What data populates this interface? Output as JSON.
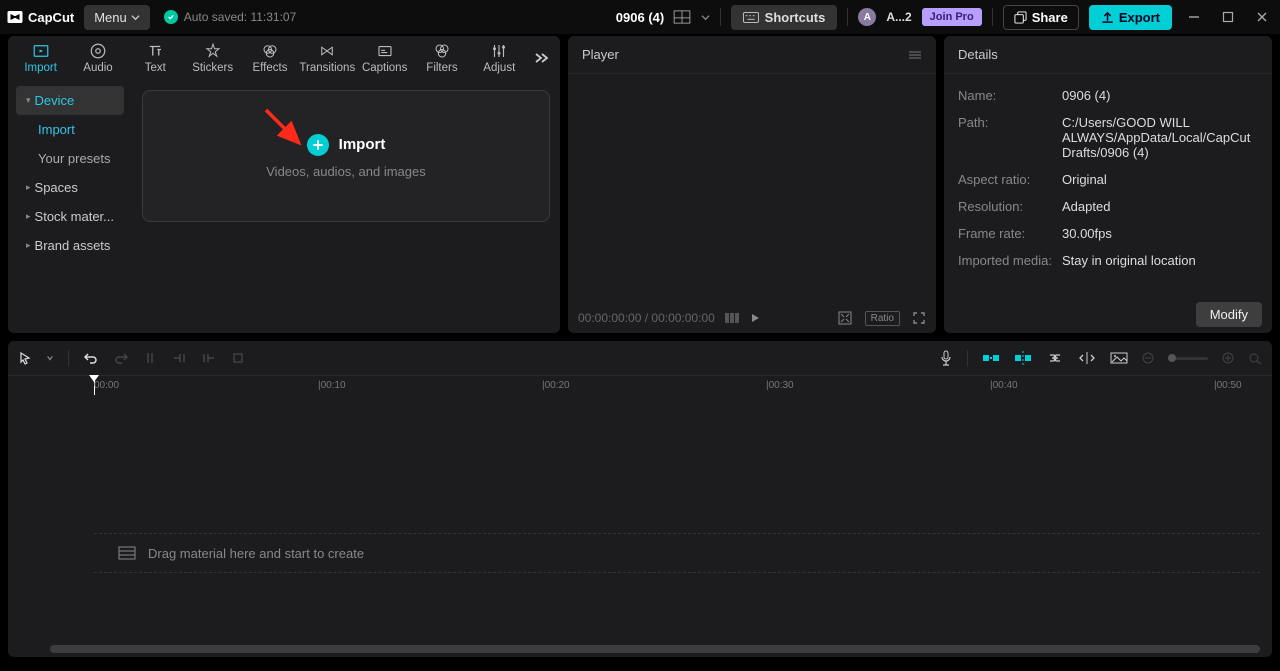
{
  "app": {
    "name": "CapCut"
  },
  "titlebar": {
    "menu_label": "Menu",
    "autosave": "Auto saved: 11:31:07",
    "project_title": "0906 (4)",
    "shortcuts_label": "Shortcuts",
    "username": "A...2",
    "joinpro_label": "Join Pro",
    "share_label": "Share",
    "export_label": "Export"
  },
  "toolTabs": [
    {
      "label": "Import",
      "icon": "import-icon",
      "active": true
    },
    {
      "label": "Audio",
      "icon": "audio-icon"
    },
    {
      "label": "Text",
      "icon": "text-icon"
    },
    {
      "label": "Stickers",
      "icon": "stickers-icon"
    },
    {
      "label": "Effects",
      "icon": "effects-icon"
    },
    {
      "label": "Transitions",
      "icon": "transitions-icon"
    },
    {
      "label": "Captions",
      "icon": "captions-icon"
    },
    {
      "label": "Filters",
      "icon": "filters-icon"
    },
    {
      "label": "Adjust",
      "icon": "adjust-icon"
    }
  ],
  "sidebar": {
    "device": "Device",
    "import": "Import",
    "presets": "Your presets",
    "spaces": "Spaces",
    "stock": "Stock mater...",
    "brand": "Brand assets"
  },
  "importBox": {
    "title": "Import",
    "subtitle": "Videos, audios, and images"
  },
  "player": {
    "header": "Player",
    "timecode": "00:00:00:00 / 00:00:00:00",
    "ratio_label": "Ratio"
  },
  "details": {
    "header": "Details",
    "rows": {
      "name_k": "Name:",
      "name_v": "0906 (4)",
      "path_k": "Path:",
      "path_v": "C:/Users/GOOD WILL ALWAYS/AppData/Local/CapCut Drafts/0906 (4)",
      "aspect_k": "Aspect ratio:",
      "aspect_v": "Original",
      "res_k": "Resolution:",
      "res_v": "Adapted",
      "fps_k": "Frame rate:",
      "fps_v": "30.00fps",
      "media_k": "Imported media:",
      "media_v": "Stay in original location"
    },
    "modify_label": "Modify"
  },
  "timeline": {
    "ticks": [
      "00:00",
      "|00:10",
      "|00:20",
      "|00:30",
      "|00:40",
      "|00:50"
    ],
    "drop_hint": "Drag material here and start to create"
  }
}
